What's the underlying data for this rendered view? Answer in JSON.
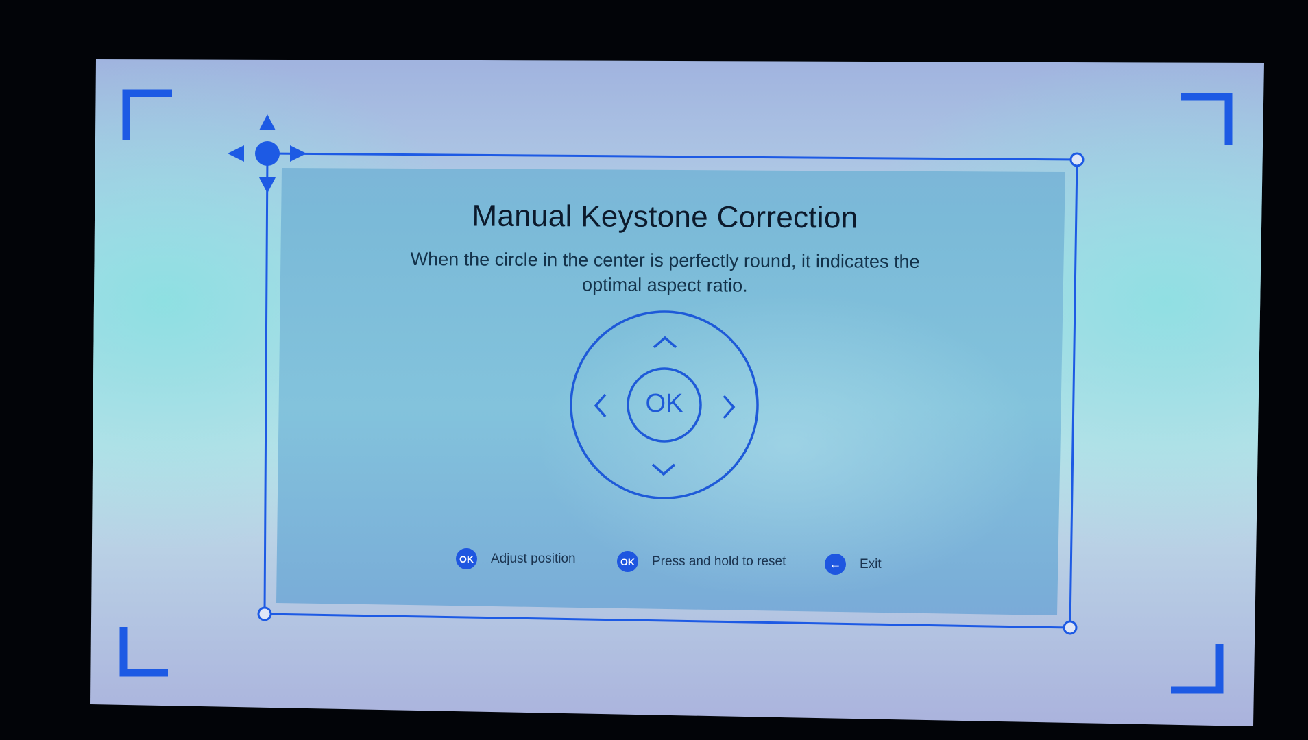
{
  "screen": {
    "title": "Manual Keystone Correction",
    "description_line1": "When the circle in the center is perfectly round, it indicates the",
    "description_line2": "optimal aspect ratio."
  },
  "dpad": {
    "center_label": "OK",
    "up_icon": "chevron-up-icon",
    "down_icon": "chevron-down-icon",
    "left_icon": "chevron-left-icon",
    "right_icon": "chevron-right-icon"
  },
  "hints": [
    {
      "icon_text": "OK",
      "label": "Adjust position"
    },
    {
      "icon_text": "OK",
      "label": "Press and hold to reset"
    },
    {
      "icon_text": "←",
      "label": "Exit"
    }
  ],
  "corner_handle": {
    "icon": "move-arrows-icon"
  },
  "colors": {
    "accent": "#1e56e0",
    "text_dark": "#0c1a2c",
    "background": "#020408"
  }
}
